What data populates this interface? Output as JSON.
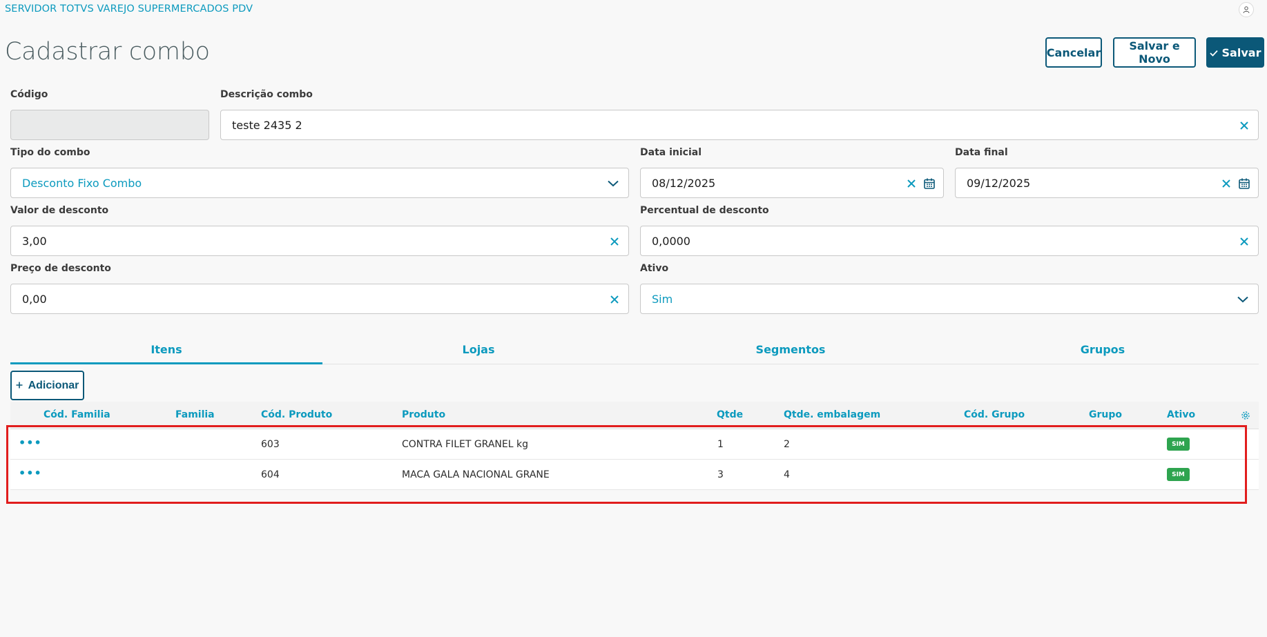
{
  "header": {
    "app_title": "SERVIDOR TOTVS VAREJO SUPERMERCADOS PDV",
    "user_icon": "user-icon"
  },
  "page": {
    "title": "Cadastrar combo"
  },
  "actions": {
    "cancel_label": "Cancelar",
    "save_new_label": "Salvar e Novo",
    "save_label": "Salvar",
    "save_icon": "check-icon"
  },
  "form": {
    "codigo": {
      "label": "Código",
      "value": ""
    },
    "descricao": {
      "label": "Descrição combo",
      "value": "teste 2435 2"
    },
    "tipo": {
      "label": "Tipo do combo",
      "value": "Desconto Fixo Combo"
    },
    "data_inicial": {
      "label": "Data inicial",
      "value": "08/12/2025"
    },
    "data_final": {
      "label": "Data final",
      "value": "09/12/2025"
    },
    "valor_desconto": {
      "label": "Valor de desconto",
      "value": "3,00"
    },
    "percentual_desconto": {
      "label": "Percentual de desconto",
      "value": "0,0000"
    },
    "preco_desconto": {
      "label": "Preço de desconto",
      "value": "0,00"
    },
    "ativo": {
      "label": "Ativo",
      "value": "Sim"
    }
  },
  "tabs": [
    {
      "label": "Itens",
      "active": true
    },
    {
      "label": "Lojas",
      "active": false
    },
    {
      "label": "Segmentos",
      "active": false
    },
    {
      "label": "Grupos",
      "active": false
    }
  ],
  "grid": {
    "add_label": "Adicionar",
    "columns": [
      "Cód. Familia",
      "Familia",
      "Cód. Produto",
      "Produto",
      "Qtde",
      "Qtde. embalagem",
      "Cód. Grupo",
      "Grupo",
      "Ativo"
    ],
    "rows": [
      {
        "cod_familia": "",
        "familia": "",
        "cod_produto": "603",
        "produto": "CONTRA FILET GRANEL kg",
        "qtde": "1",
        "qtde_embalagem": "2",
        "cod_grupo": "",
        "grupo": "",
        "ativo": "SIM"
      },
      {
        "cod_familia": "",
        "familia": "",
        "cod_produto": "604",
        "produto": "MACA GALA NACIONAL GRANE",
        "qtde": "3",
        "qtde_embalagem": "4",
        "cod_grupo": "",
        "grupo": "",
        "ativo": "SIM"
      }
    ],
    "row_action": "•••",
    "settings_icon": "gear-icon"
  },
  "colors": {
    "accent": "#0c9abe",
    "primary": "#0b5878",
    "success": "#2ea44f",
    "highlight": "#e11d1d"
  }
}
